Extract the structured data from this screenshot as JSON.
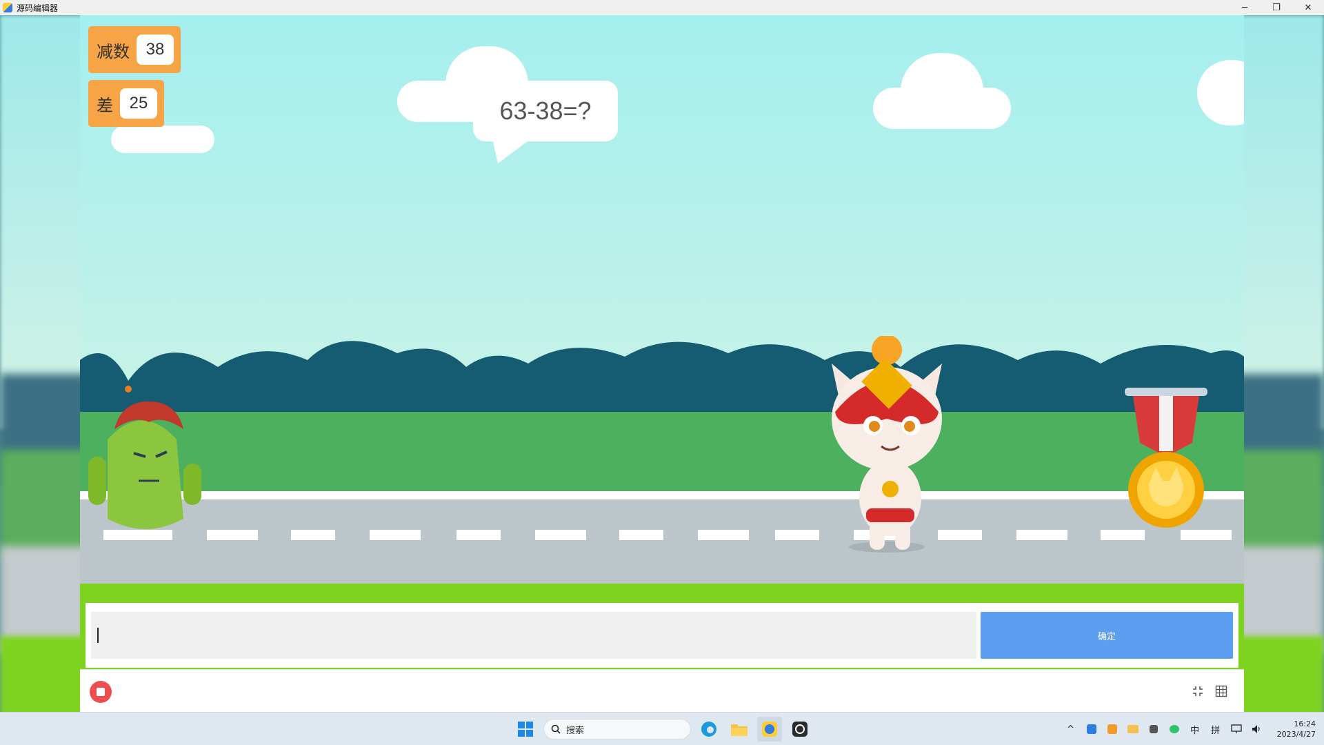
{
  "window": {
    "title": "源码编辑器",
    "minimize": "─",
    "restore": "❐",
    "close": "✕"
  },
  "stage": {
    "variables": [
      {
        "label": "减数",
        "value": "38"
      },
      {
        "label": "差",
        "value": "25"
      }
    ],
    "speech_bubble": "63-38=?",
    "characters": [
      "cactus",
      "cat-hero",
      "medal"
    ]
  },
  "answer": {
    "input_value": "",
    "input_placeholder": "",
    "confirm_label": "确定"
  },
  "controls": {
    "stop_icon": "stop-icon",
    "shrink_icon": "shrink-icon",
    "grid_icon": "grid-icon"
  },
  "taskbar": {
    "search_label": "搜索",
    "ime_mode": "中",
    "ime_pinyin": "拼",
    "time": "16:24",
    "date": "2023/4/27"
  },
  "colors": {
    "variable_box": "#f6a445",
    "confirm_button": "#5c9ef0",
    "stop_button": "#ec4f4f",
    "frame_green": "#7ed321"
  }
}
